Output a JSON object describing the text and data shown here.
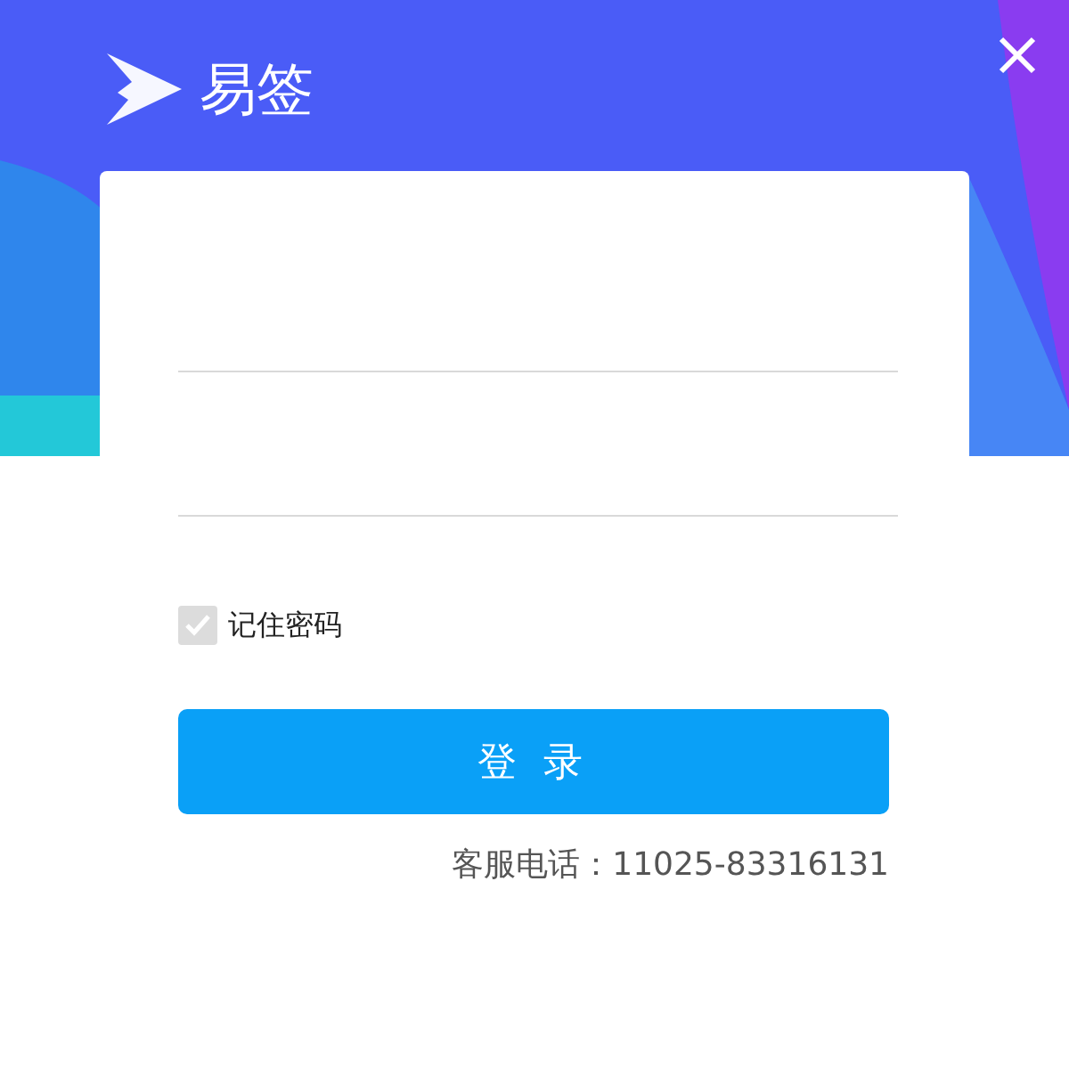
{
  "app": {
    "title": "易签"
  },
  "form": {
    "remember": {
      "label": "记住密码",
      "checked": true
    },
    "submit": "登 录",
    "hotline": "客服电话：11025-83316131"
  }
}
